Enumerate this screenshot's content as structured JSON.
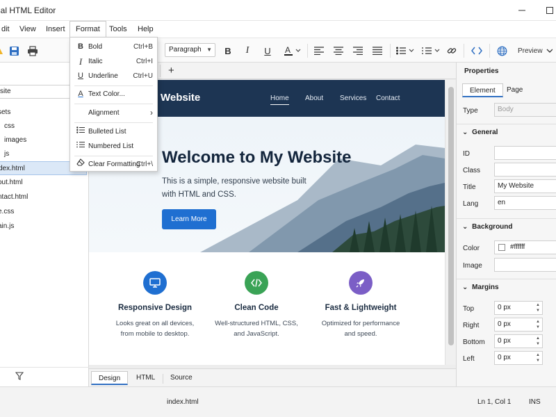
{
  "window": {
    "title": "ual HTML Editor"
  },
  "menu": {
    "items": [
      "dit",
      "View",
      "Insert",
      "Format",
      "Tools",
      "Help"
    ],
    "active": "Format"
  },
  "toolbar": {
    "paragraph": "Paragraph",
    "preview": "Preview"
  },
  "format_menu": {
    "bold": {
      "label": "Bold",
      "shortcut": "Ctrl+B"
    },
    "italic": {
      "label": "Italic",
      "shortcut": "Ctrl+I"
    },
    "underline": {
      "label": "Underline",
      "shortcut": "Ctrl+U"
    },
    "text_color": {
      "label": "Text Color..."
    },
    "alignment": {
      "label": "Alignment"
    },
    "bulleted_list": {
      "label": "Bulleted List"
    },
    "numbered_list": {
      "label": "Numbered List"
    },
    "clear_formatting": {
      "label": "Clear Formatting",
      "shortcut": "Ctrl+\\"
    }
  },
  "file_panel": {
    "search_value": "site",
    "tree": [
      "sets",
      "css",
      "images",
      "js",
      "dex.html",
      "out.html",
      "ntact.html",
      "e.css",
      "ain.js"
    ],
    "selected": "dex.html"
  },
  "editor": {
    "tab_add": "+",
    "bottom_tabs": [
      "Design",
      "HTML",
      "Source"
    ],
    "active_bottom_tab": "Design"
  },
  "site": {
    "brand": "Website",
    "nav": [
      "Home",
      "About",
      "Services",
      "Contact"
    ],
    "active_nav": "Home",
    "hero_title": "Welcome to My  Website",
    "hero_sub": "This is a simple, responsive website built with HTML and CSS.",
    "hero_button": "Learn More",
    "features": [
      {
        "title": "Responsive Design",
        "desc1": "Looks great on all devices,",
        "desc2": "from mobile to desktop.",
        "color": "#1f6fd1"
      },
      {
        "title": "Clean Code",
        "desc1": "Well-structured HTML, CSS,",
        "desc2": "and JavaScript.",
        "color": "#3aa356"
      },
      {
        "title": "Fast & Lightweight",
        "desc1": "Optimized for performance",
        "desc2": "and speed.",
        "color": "#7b5ec6"
      }
    ]
  },
  "properties": {
    "title": "Properties",
    "tabs": [
      "Element",
      "Page"
    ],
    "active_tab": "Element",
    "type_label": "Type",
    "type_value": "Body",
    "general": {
      "header": "General",
      "id_label": "ID",
      "id_value": "",
      "class_label": "Class",
      "class_value": "",
      "title_label": "Title",
      "title_value": "My Website",
      "lang_label": "Lang",
      "lang_value": "en"
    },
    "background": {
      "header": "Background",
      "color_label": "Color",
      "color_value": "#ffffff",
      "image_label": "Image",
      "image_value": ""
    },
    "margins": {
      "header": "Margins",
      "top_label": "Top",
      "top": "0 px",
      "right_label": "Right",
      "right": "0 px",
      "bottom_label": "Bottom",
      "bottom": "0 px",
      "left_label": "Left",
      "left": "0 px"
    }
  },
  "status": {
    "file": "index.html",
    "position": "Ln 1, Col 1",
    "mode": "INS"
  }
}
